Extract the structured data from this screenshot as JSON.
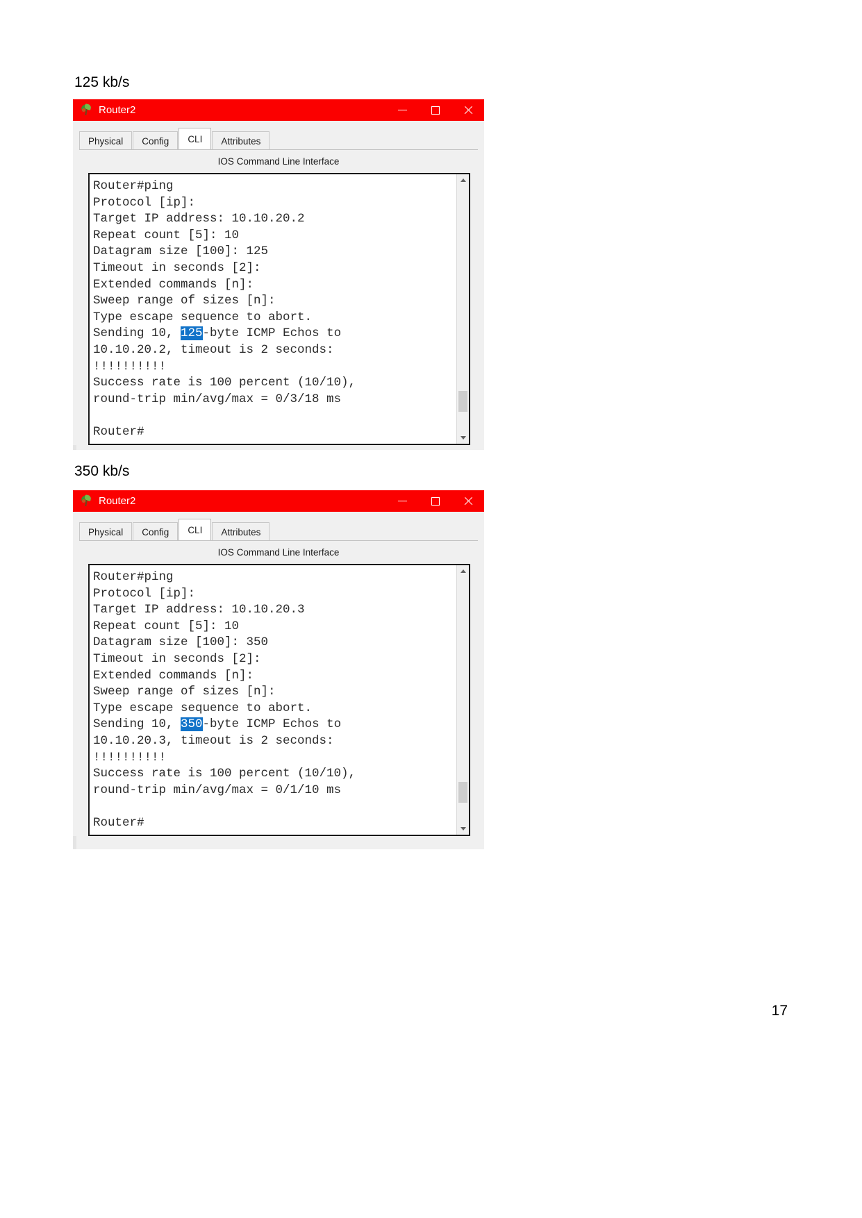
{
  "document": {
    "page_number": "17",
    "captions": [
      {
        "text": "125 kb/s"
      },
      {
        "text": "350 kb/s"
      }
    ]
  },
  "colors": {
    "titlebar": "#fb0000",
    "titlebar_text": "#ffffff",
    "selection_highlight": "#1273c9",
    "window_chrome": "#f0f0f0",
    "terminal_background": "#ffffff",
    "terminal_text": "#2b2b2b"
  },
  "windows": [
    {
      "title": "Router2",
      "icon": "packet-tracer-logo-icon",
      "controls": {
        "minimize": "minimize-icon",
        "maximize": "maximize-icon",
        "close": "close-icon"
      },
      "tabs": [
        {
          "label": "Physical",
          "active": false
        },
        {
          "label": "Config",
          "active": false
        },
        {
          "label": "CLI",
          "active": true
        },
        {
          "label": "Attributes",
          "active": false
        }
      ],
      "panel_title": "IOS Command Line Interface",
      "terminal": {
        "lines": [
          {
            "text": "Router#ping"
          },
          {
            "text": "Protocol [ip]:"
          },
          {
            "text": "Target IP address: 10.10.20.2"
          },
          {
            "text": "Repeat count [5]: 10"
          },
          {
            "text": "Datagram size [100]: 125"
          },
          {
            "text": "Timeout in seconds [2]:"
          },
          {
            "text": "Extended commands [n]:"
          },
          {
            "text": "Sweep range of sizes [n]:"
          },
          {
            "text": "Type escape sequence to abort."
          },
          {
            "pre": "Sending 10, ",
            "highlight": "125",
            "post": "-byte ICMP Echos to"
          },
          {
            "text": "10.10.20.2, timeout is 2 seconds:"
          },
          {
            "text": "!!!!!!!!!!"
          },
          {
            "text": "Success rate is 100 percent (10/10),"
          },
          {
            "text": "round-trip min/avg/max = 0/3/18 ms"
          },
          {
            "text": ""
          },
          {
            "text": "Router#"
          }
        ]
      }
    },
    {
      "title": "Router2",
      "icon": "packet-tracer-logo-icon",
      "controls": {
        "minimize": "minimize-icon",
        "maximize": "maximize-icon",
        "close": "close-icon"
      },
      "tabs": [
        {
          "label": "Physical",
          "active": false
        },
        {
          "label": "Config",
          "active": false
        },
        {
          "label": "CLI",
          "active": true
        },
        {
          "label": "Attributes",
          "active": false
        }
      ],
      "panel_title": "IOS Command Line Interface",
      "terminal": {
        "lines": [
          {
            "text": "Router#ping"
          },
          {
            "text": "Protocol [ip]:"
          },
          {
            "text": "Target IP address: 10.10.20.3"
          },
          {
            "text": "Repeat count [5]: 10"
          },
          {
            "text": "Datagram size [100]: 350"
          },
          {
            "text": "Timeout in seconds [2]:"
          },
          {
            "text": "Extended commands [n]:"
          },
          {
            "text": "Sweep range of sizes [n]:"
          },
          {
            "text": "Type escape sequence to abort."
          },
          {
            "pre": "Sending 10, ",
            "highlight": "350",
            "post": "-byte ICMP Echos to"
          },
          {
            "text": "10.10.20.3, timeout is 2 seconds:"
          },
          {
            "text": "!!!!!!!!!!"
          },
          {
            "text": "Success rate is 100 percent (10/10),"
          },
          {
            "text": "round-trip min/avg/max = 0/1/10 ms"
          },
          {
            "text": ""
          },
          {
            "text": "Router#"
          }
        ]
      }
    }
  ]
}
